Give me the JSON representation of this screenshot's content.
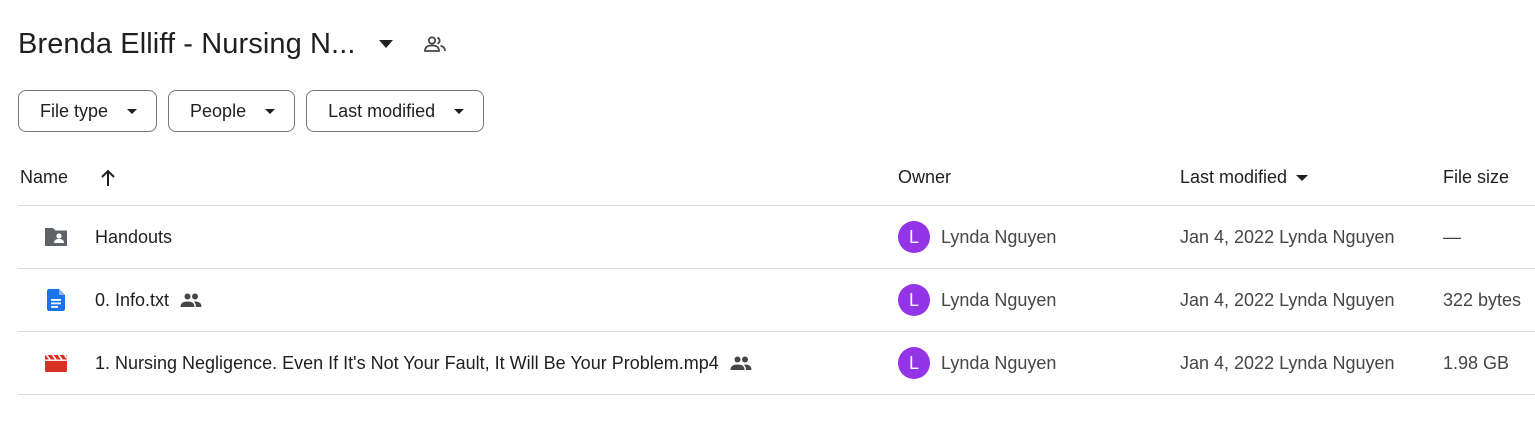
{
  "folder": {
    "title": "Brenda Elliff - Nursing N...",
    "caret_icon": "arrow-drop-down-icon",
    "shared_icon": "people-outline-icon"
  },
  "filters": [
    {
      "label": "File type"
    },
    {
      "label": "People"
    },
    {
      "label": "Last modified"
    }
  ],
  "columns": {
    "name": "Name",
    "owner": "Owner",
    "last_modified": "Last modified",
    "file_size": "File size"
  },
  "rows": [
    {
      "name": "Handouts",
      "icon": "shared-folder-icon",
      "shared": false,
      "owner_initial": "L",
      "owner": "Lynda Nguyen",
      "last_modified": "Jan 4, 2022 Lynda Nguyen",
      "file_size": "—"
    },
    {
      "name": "0. Info.txt",
      "icon": "text-document-icon",
      "shared": true,
      "owner_initial": "L",
      "owner": "Lynda Nguyen",
      "last_modified": "Jan 4, 2022 Lynda Nguyen",
      "file_size": "322 bytes"
    },
    {
      "name": "1. Nursing Negligence.  Even If It's Not Your Fault, It Will Be Your Problem.mp4",
      "icon": "video-file-icon",
      "shared": true,
      "owner_initial": "L",
      "owner": "Lynda Nguyen",
      "last_modified": "Jan 4, 2022 Lynda Nguyen",
      "file_size": "1.98 GB"
    }
  ],
  "colors": {
    "avatar": "#9334e6",
    "folder_icon": "#5f6368",
    "doc_icon": "#1a73e8",
    "video_icon": "#d93025",
    "text_primary": "#1f1f1f",
    "text_secondary": "#444746",
    "divider": "#dadce0"
  }
}
